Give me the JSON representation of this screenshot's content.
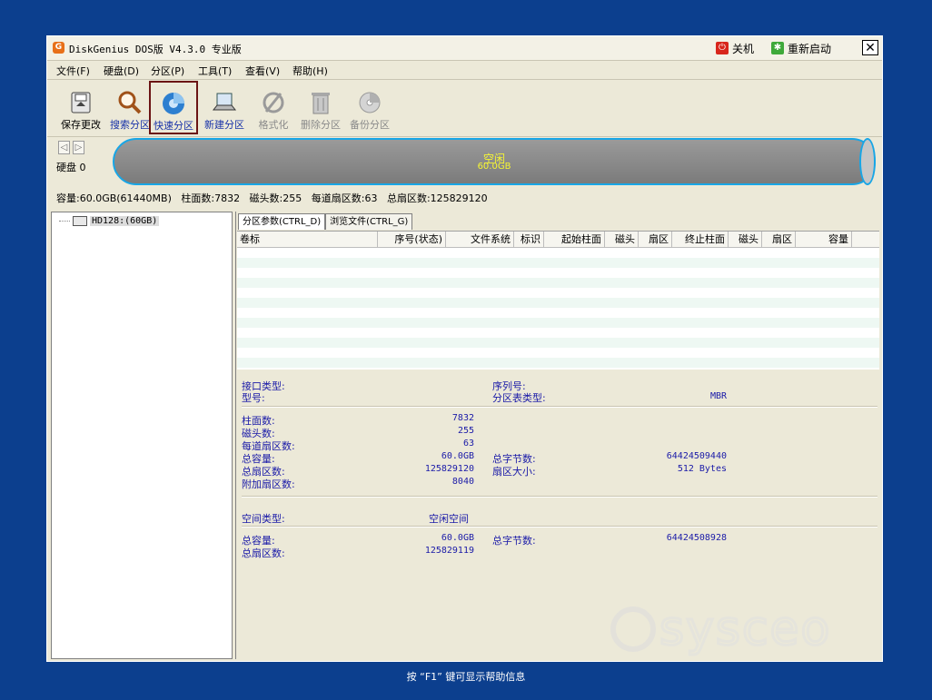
{
  "window": {
    "title": "DiskGenius DOS版 V4.3.0 专业版",
    "app_icon_glyph": "G",
    "power_label": "关机",
    "restart_label": "重新启动",
    "close_glyph": "✕"
  },
  "menu": [
    "文件(F)",
    "硬盘(D)",
    "分区(P)",
    "工具(T)",
    "查看(V)",
    "帮助(H)"
  ],
  "toolbar": [
    {
      "label": "保存更改",
      "icon": "save-disk-icon",
      "state": "normal"
    },
    {
      "label": "搜索分区",
      "icon": "magnifier-icon",
      "state": "blue"
    },
    {
      "label": "快速分区",
      "icon": "quick-partition-icon",
      "state": "selected"
    },
    {
      "label": "新建分区",
      "icon": "laptop-icon",
      "state": "blue"
    },
    {
      "label": "格式化",
      "icon": "format-icon",
      "state": "disabled"
    },
    {
      "label": "删除分区",
      "icon": "trash-icon",
      "state": "disabled"
    },
    {
      "label": "备份分区",
      "icon": "backup-disc-icon",
      "state": "disabled"
    }
  ],
  "disk": {
    "label": "硬盘 0",
    "nav_left": "◁",
    "nav_right": "▷",
    "bar_line1": "空闲",
    "bar_line2": "60.0GB",
    "bar_color": "#18a6e6",
    "info": "容量:60.0GB(61440MB)   柱面数:7832   磁头数:255   每道扇区数:63   总扇区数:125829120"
  },
  "tree": {
    "node_label": "HD128:(60GB)"
  },
  "tabs": [
    "分区参数(CTRL_D)",
    "浏览文件(CTRL_G)"
  ],
  "grid": {
    "columns": [
      {
        "label": "卷标",
        "w": 155,
        "align": "left"
      },
      {
        "label": "序号(状态)",
        "w": 75,
        "align": "right"
      },
      {
        "label": "文件系统",
        "w": 75,
        "align": "right"
      },
      {
        "label": "标识",
        "w": 33,
        "align": "right"
      },
      {
        "label": "起始柱面",
        "w": 67,
        "align": "right"
      },
      {
        "label": "磁头",
        "w": 37,
        "align": "right"
      },
      {
        "label": "扇区",
        "w": 37,
        "align": "right"
      },
      {
        "label": "终止柱面",
        "w": 62,
        "align": "right"
      },
      {
        "label": "磁头",
        "w": 37,
        "align": "right"
      },
      {
        "label": "扇区",
        "w": 37,
        "align": "right"
      },
      {
        "label": "容量",
        "w": 62,
        "align": "right"
      }
    ]
  },
  "details": {
    "interface_label": "接口类型:",
    "model_label": "型号:",
    "serial_label": "序列号:",
    "pt_type_label": "分区表类型:",
    "pt_type_value": "MBR",
    "cylinders_label": "柱面数:",
    "cylinders_value": "7832",
    "heads_label": "磁头数:",
    "heads_value": "255",
    "spt_label": "每道扇区数:",
    "spt_value": "63",
    "capacity_label": "总容量:",
    "capacity_value": "60.0GB",
    "total_bytes_label": "总字节数:",
    "total_bytes_value": "64424509440",
    "total_sectors_label": "总扇区数:",
    "total_sectors_value": "125829120",
    "sector_size_label": "扇区大小:",
    "sector_size_value": "512 Bytes",
    "extra_sectors_label": "附加扇区数:",
    "extra_sectors_value": "8040",
    "free_type_label": "空间类型:",
    "free_type_value": "空闲空间",
    "free_capacity_label": "总容量:",
    "free_capacity_value": "60.0GB",
    "free_bytes_label": "总字节数:",
    "free_bytes_value": "64424508928",
    "free_sectors_label": "总扇区数:",
    "free_sectors_value": "125829119"
  },
  "status_text": "按 “F1” 键可显示帮助信息",
  "watermark": "sysceo"
}
